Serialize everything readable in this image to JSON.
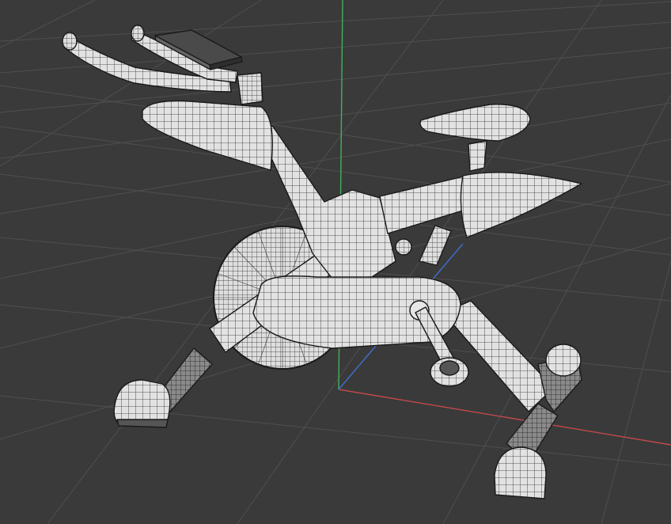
{
  "viewport": {
    "view": "perspective",
    "shading": "wireframe-on-shaded",
    "background_color": "#3a3a3a",
    "grid_color": "#505050",
    "mesh_fill_color": "#e4e4e4",
    "wire_color": "#1a1a1a"
  },
  "axes": {
    "x_color": "#c0494a",
    "y_color": "#43b05c",
    "z_color": "#3f6fd0"
  },
  "model": {
    "object": "exercise-bike",
    "parts": [
      "handlebars",
      "display-screen",
      "front-fork-cover",
      "main-frame",
      "seat",
      "seat-post-cover",
      "flywheel",
      "crank-arm",
      "pedal",
      "front-stabilizer",
      "rear-stabilizer",
      "shock-damper"
    ]
  }
}
